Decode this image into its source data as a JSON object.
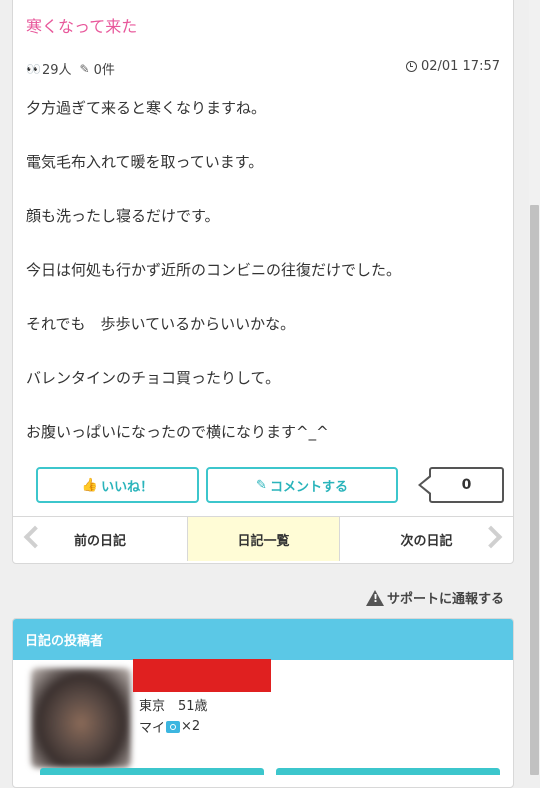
{
  "diary": {
    "title": "寒くなって来た",
    "views": "29人",
    "comments_count_label": "0件",
    "date": "02/01 17:57",
    "body": [
      "夕方過ぎて来ると寒くなりますね。",
      "電気毛布入れて暖を取っています。",
      "顔も洗ったし寝るだけです。",
      "今日は何処も行かず近所のコンビニの往復だけでした。",
      "それでも　歩歩いているからいいかな。",
      "バレンタインのチョコ買ったりして。",
      "お腹いっぱいになったので横になります^_^"
    ]
  },
  "actions": {
    "like_label": "いいね！",
    "comment_label": "コメントする",
    "like_count": "0"
  },
  "nav": {
    "prev_label": "前の日記",
    "list_label": "日記一覧",
    "next_label": "次の日記"
  },
  "report_label": "サポートに通報する",
  "poster": {
    "header": "日記の投稿者",
    "location": "東京　51歳",
    "photos_prefix": "マイ",
    "photos_suffix": "×2"
  },
  "colors": {
    "title": "#e8589b",
    "accent": "#3cc6cc",
    "header": "#5bc8e6",
    "nav_highlight": "#fffcd6"
  }
}
